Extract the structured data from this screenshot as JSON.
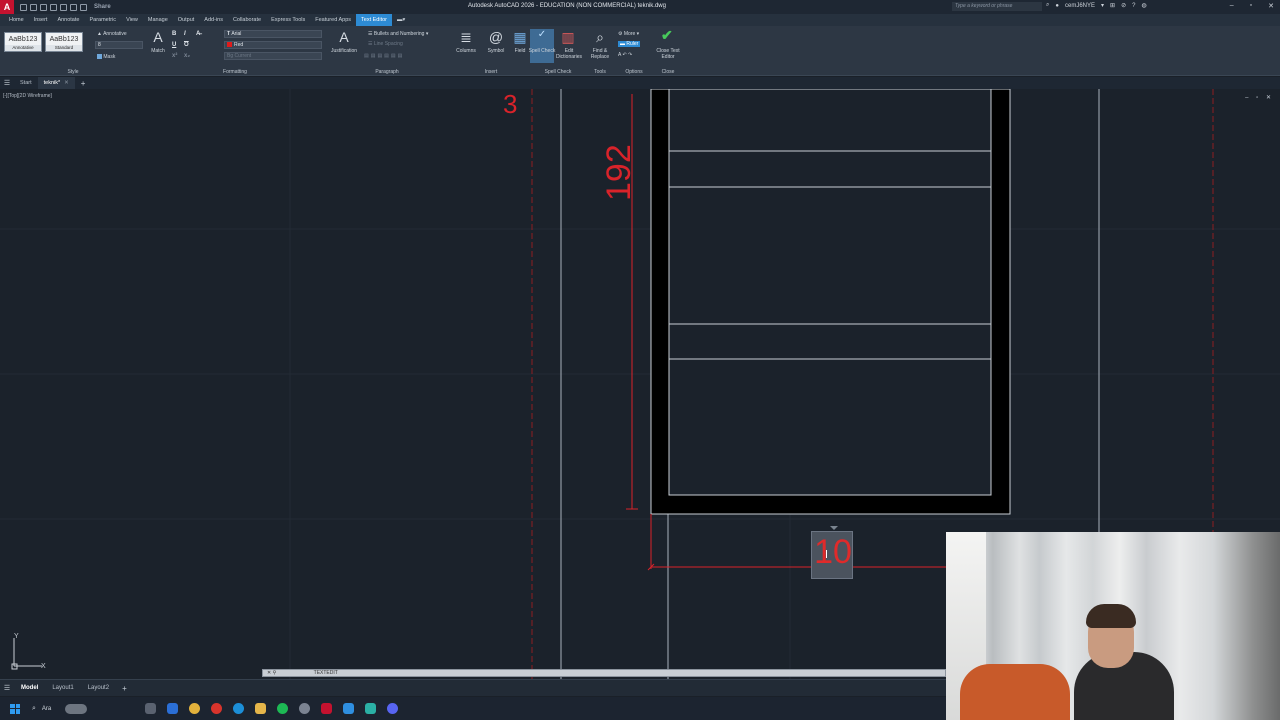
{
  "app": {
    "logo": "A",
    "share": "Share",
    "title": "Autodesk AutoCAD 2026 - EDUCATION (NON COMMERCIAL)   teknik.dwg",
    "search_placeholder": "Type a keyword or phrase",
    "user": "cemJ6NYE"
  },
  "ribbon_tabs": [
    "Home",
    "Insert",
    "Annotate",
    "Parametric",
    "View",
    "Manage",
    "Output",
    "Add-ins",
    "Collaborate",
    "Express Tools",
    "Featured Apps",
    "Text Editor"
  ],
  "ribbon": {
    "style": {
      "swatch1": "AaBb123",
      "swatch1_label": "Annotative",
      "swatch2": "AaBb123",
      "swatch2_label": "Standard",
      "annotative": "Annotative",
      "height": "8",
      "mask": "Mask",
      "group_label": "Style"
    },
    "formatting": {
      "match": "Match",
      "bold": "B",
      "italic": "I",
      "underline": "U",
      "overline": "O",
      "font": "Arial",
      "color": "Red",
      "bg": "Bg Current",
      "group_label": "Formatting"
    },
    "paragraph": {
      "justification": "Justification",
      "bullets": "Bullets and Numbering",
      "line_spacing": "Line Spacing",
      "group_label": "Paragraph"
    },
    "insert": {
      "columns": "Columns",
      "symbol": "Symbol",
      "field": "Field",
      "group_label": "Insert"
    },
    "spell": {
      "spell_check": "Spell Check",
      "edit_dict": "Edit Dictionaries",
      "group_label": "Spell Check"
    },
    "tools": {
      "find_replace": "Find & Replace",
      "group_label": "Tools"
    },
    "options": {
      "more": "More",
      "ruler": "Ruler",
      "group_label": "Options"
    },
    "close": {
      "close_editor": "Close Text Editor",
      "group_label": "Close"
    }
  },
  "doc_tabs": {
    "start": "Start",
    "file": "teknik"
  },
  "viewport": {
    "label": "[-][Top][2D Wireframe]",
    "ctrls": "– ▫ ✕"
  },
  "drawing": {
    "dim_top": "3",
    "dim_vertical": "192",
    "edit_text": "10"
  },
  "command_line": {
    "text": "TEXTEDIT"
  },
  "ucs": {
    "y": "Y",
    "x": "X"
  },
  "layout_tabs": [
    "Model",
    "Layout1",
    "Layout2"
  ],
  "taskbar": {
    "search": "Ara"
  },
  "colors": {
    "accent": "#2d8bd4",
    "dimension": "#d9232a"
  }
}
